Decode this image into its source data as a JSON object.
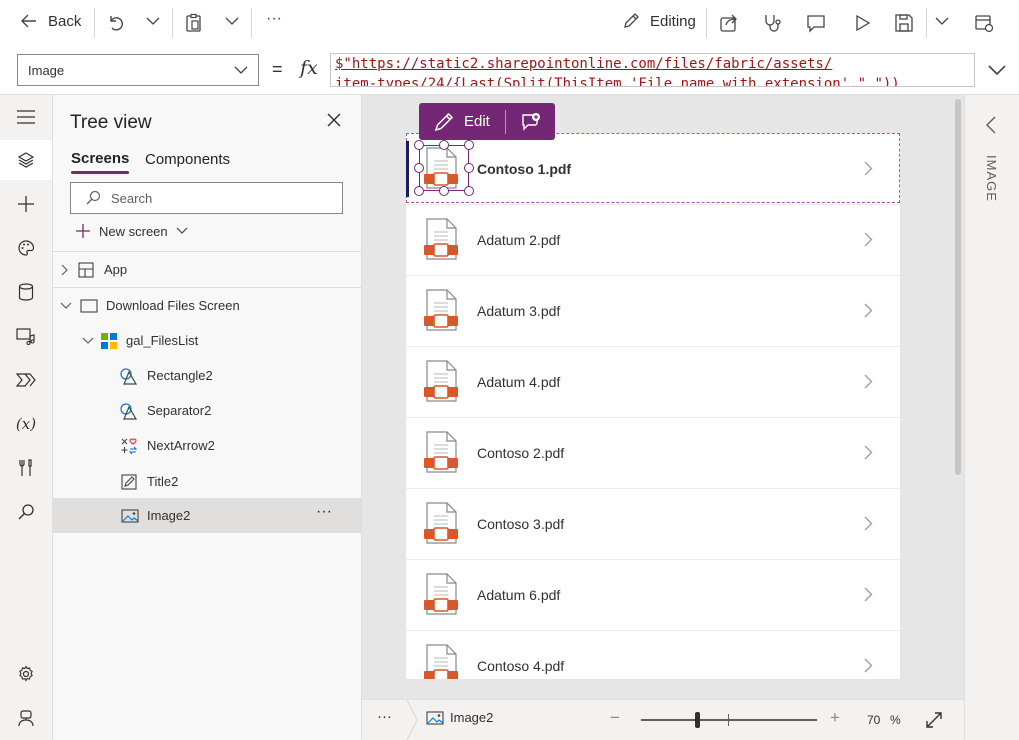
{
  "toolbar": {
    "back_label": "Back",
    "editing_label": "Editing",
    "more_label": "···"
  },
  "formula": {
    "property": "Image",
    "equals": "=",
    "fx": "fx",
    "line1": "$\"https://static2.sharepointonline.com/files/fabric/assets/",
    "line2": "item-types/24/{Last(Split(ThisItem.'File name with extension',\".\"))"
  },
  "tree": {
    "title": "Tree view",
    "tabs": [
      "Screens",
      "Components"
    ],
    "search_placeholder": "Search",
    "new_screen": "New screen",
    "items": [
      {
        "label": "App"
      },
      {
        "label": "Download Files Screen"
      },
      {
        "label": "gal_FilesList"
      },
      {
        "label": "Rectangle2"
      },
      {
        "label": "Separator2"
      },
      {
        "label": "NextArrow2"
      },
      {
        "label": "Title2"
      },
      {
        "label": "Image2"
      }
    ],
    "more": "···"
  },
  "canvas": {
    "edit_label": "Edit",
    "files": [
      "Contoso 1.pdf",
      "Adatum 2.pdf",
      "Adatum 3.pdf",
      "Adatum 4.pdf",
      "Contoso 2.pdf",
      "Contoso 3.pdf",
      "Adatum 6.pdf",
      "Contoso 4.pdf"
    ]
  },
  "bottom": {
    "more": "···",
    "selected": "Image2",
    "minus": "−",
    "plus": "+",
    "zoom": "70",
    "zoom_unit": "%"
  },
  "rpanel": {
    "label": "IMAGE"
  },
  "colors": {
    "accent": "#742774",
    "file_orange": "#d9582b",
    "selection_bar": "#1a1a5e"
  }
}
